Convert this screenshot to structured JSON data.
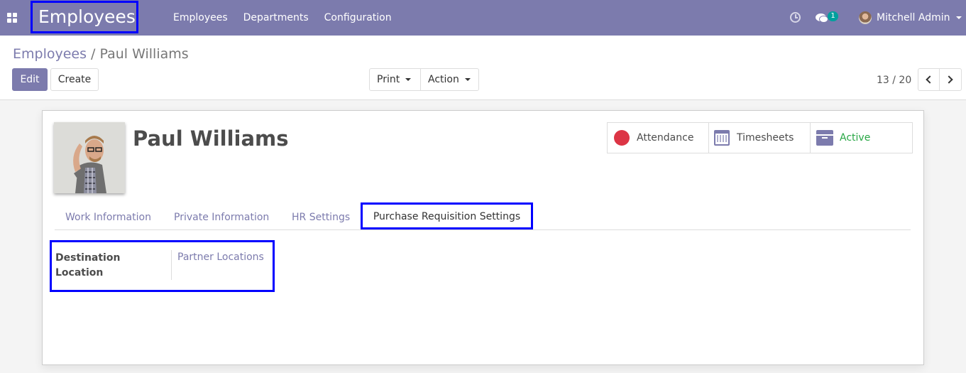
{
  "navbar": {
    "app_title": "Employees",
    "menu": [
      "Employees",
      "Departments",
      "Configuration"
    ],
    "chat_count": "1",
    "user_name": "Mitchell Admin"
  },
  "control_panel": {
    "breadcrumb": {
      "parent": "Employees",
      "separator": "/",
      "current": "Paul Williams"
    },
    "edit_label": "Edit",
    "create_label": "Create",
    "print_label": "Print",
    "action_label": "Action",
    "pager": "13 / 20"
  },
  "employee": {
    "name": "Paul Williams",
    "stat_buttons": {
      "attendance": "Attendance",
      "timesheets": "Timesheets",
      "active": "Active"
    },
    "status_colors": {
      "attendance": "#dc3545",
      "active": "#28a745",
      "accent": "#7c7bad"
    }
  },
  "tabs": [
    "Work Information",
    "Private Information",
    "HR Settings",
    "Purchase Requisition Settings"
  ],
  "active_tab": "Purchase Requisition Settings",
  "purchase_settings": {
    "field_label": "Destination Location",
    "field_value": "Partner Locations"
  }
}
